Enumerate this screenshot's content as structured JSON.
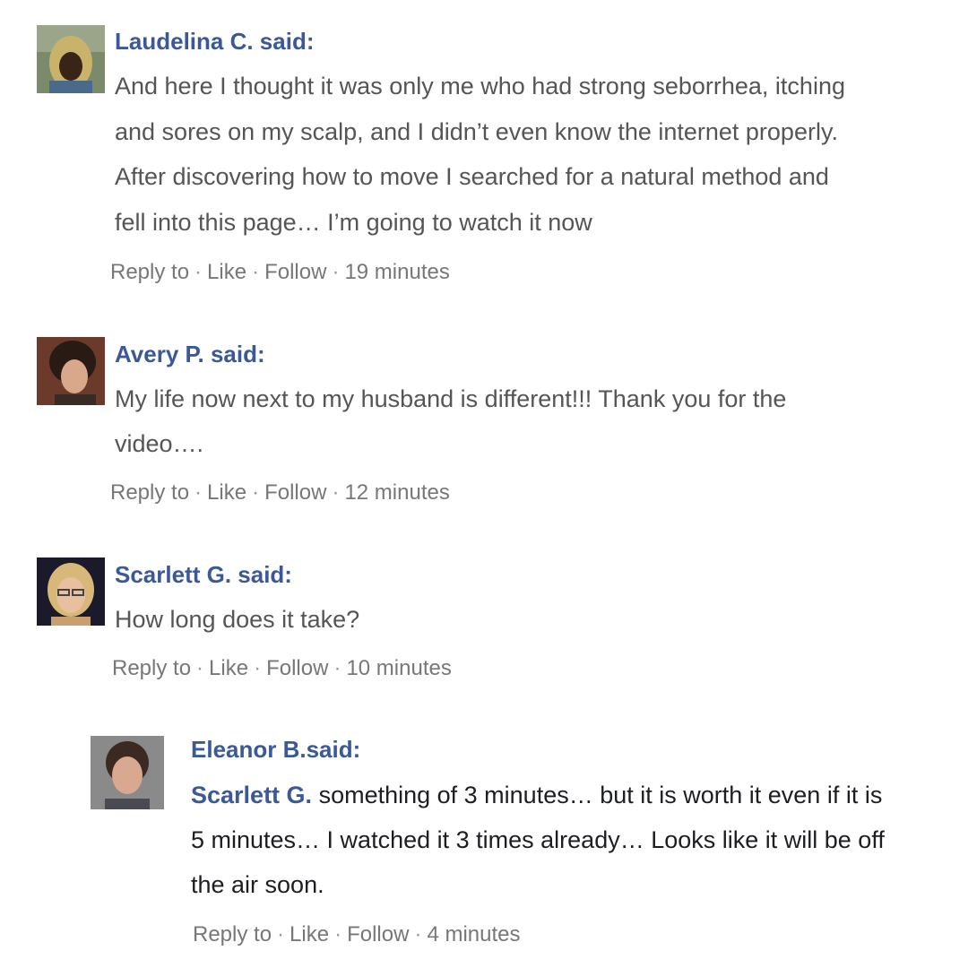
{
  "comments": [
    {
      "author": "Laudelina C. said:",
      "lines": [
        "And here I thought it was only me who had strong seborrhea, itching",
        "and sores on my scalp, and I didn’t even know the internet properly.",
        "After discovering how to move I searched for a natural method and",
        "fell into this page… I’m going to watch it now"
      ],
      "actions": {
        "reply": "Reply to",
        "like": "Like",
        "follow": "Follow",
        "time": "19 minutes"
      }
    },
    {
      "author": "Avery P. said:",
      "lines": [
        "My life now next to my husband is different!!! Thank you for the",
        "video…."
      ],
      "actions": {
        "reply": "Reply to",
        "like": "Like",
        "follow": "Follow",
        "time": "12 minutes"
      }
    },
    {
      "author": "Scarlett G. said:",
      "lines": [
        "How long does it take?"
      ],
      "actions": {
        "reply": "Reply to",
        "like": "Like",
        "follow": "Follow",
        "time": "10 minutes"
      }
    },
    {
      "author": "Eleanor B.said:",
      "mention": "Scarlett G.",
      "lines": [
        " something of 3 minutes… but it is worth it even if it is",
        "5 minutes… I watched it 3 times already… Looks like it will be off",
        "the air soon."
      ],
      "actions": {
        "reply": "Reply to",
        "like": "Like",
        "follow": "Follow",
        "time": "4 minutes"
      }
    }
  ],
  "separator": "·",
  "colors": {
    "author": "#3b5998",
    "body": "#555555",
    "actions": "#777777"
  }
}
